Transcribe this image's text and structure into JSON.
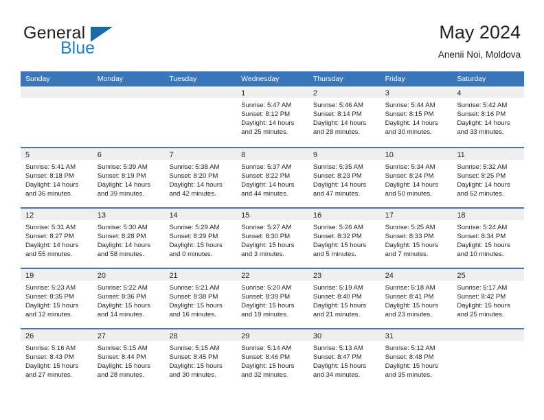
{
  "logo": {
    "word_one": "General",
    "word_two": "Blue",
    "triangle_icon": "triangle-icon"
  },
  "header": {
    "title": "May 2024",
    "location": "Anenii Noi, Moldova"
  },
  "colors": {
    "header_blue": "#3b76b8",
    "logo_blue": "#1f7fc4",
    "daynum_band": "#efefef",
    "text": "#231f20"
  },
  "weekdays": [
    "Sunday",
    "Monday",
    "Tuesday",
    "Wednesday",
    "Thursday",
    "Friday",
    "Saturday"
  ],
  "weeks": [
    [
      {
        "day": "",
        "lines": []
      },
      {
        "day": "",
        "lines": []
      },
      {
        "day": "",
        "lines": []
      },
      {
        "day": "1",
        "lines": [
          "Sunrise: 5:47 AM",
          "Sunset: 8:12 PM",
          "Daylight: 14 hours",
          "and 25 minutes."
        ]
      },
      {
        "day": "2",
        "lines": [
          "Sunrise: 5:46 AM",
          "Sunset: 8:14 PM",
          "Daylight: 14 hours",
          "and 28 minutes."
        ]
      },
      {
        "day": "3",
        "lines": [
          "Sunrise: 5:44 AM",
          "Sunset: 8:15 PM",
          "Daylight: 14 hours",
          "and 30 minutes."
        ]
      },
      {
        "day": "4",
        "lines": [
          "Sunrise: 5:42 AM",
          "Sunset: 8:16 PM",
          "Daylight: 14 hours",
          "and 33 minutes."
        ]
      }
    ],
    [
      {
        "day": "5",
        "lines": [
          "Sunrise: 5:41 AM",
          "Sunset: 8:18 PM",
          "Daylight: 14 hours",
          "and 36 minutes."
        ]
      },
      {
        "day": "6",
        "lines": [
          "Sunrise: 5:39 AM",
          "Sunset: 8:19 PM",
          "Daylight: 14 hours",
          "and 39 minutes."
        ]
      },
      {
        "day": "7",
        "lines": [
          "Sunrise: 5:38 AM",
          "Sunset: 8:20 PM",
          "Daylight: 14 hours",
          "and 42 minutes."
        ]
      },
      {
        "day": "8",
        "lines": [
          "Sunrise: 5:37 AM",
          "Sunset: 8:22 PM",
          "Daylight: 14 hours",
          "and 44 minutes."
        ]
      },
      {
        "day": "9",
        "lines": [
          "Sunrise: 5:35 AM",
          "Sunset: 8:23 PM",
          "Daylight: 14 hours",
          "and 47 minutes."
        ]
      },
      {
        "day": "10",
        "lines": [
          "Sunrise: 5:34 AM",
          "Sunset: 8:24 PM",
          "Daylight: 14 hours",
          "and 50 minutes."
        ]
      },
      {
        "day": "11",
        "lines": [
          "Sunrise: 5:32 AM",
          "Sunset: 8:25 PM",
          "Daylight: 14 hours",
          "and 52 minutes."
        ]
      }
    ],
    [
      {
        "day": "12",
        "lines": [
          "Sunrise: 5:31 AM",
          "Sunset: 8:27 PM",
          "Daylight: 14 hours",
          "and 55 minutes."
        ]
      },
      {
        "day": "13",
        "lines": [
          "Sunrise: 5:30 AM",
          "Sunset: 8:28 PM",
          "Daylight: 14 hours",
          "and 58 minutes."
        ]
      },
      {
        "day": "14",
        "lines": [
          "Sunrise: 5:29 AM",
          "Sunset: 8:29 PM",
          "Daylight: 15 hours",
          "and 0 minutes."
        ]
      },
      {
        "day": "15",
        "lines": [
          "Sunrise: 5:27 AM",
          "Sunset: 8:30 PM",
          "Daylight: 15 hours",
          "and 3 minutes."
        ]
      },
      {
        "day": "16",
        "lines": [
          "Sunrise: 5:26 AM",
          "Sunset: 8:32 PM",
          "Daylight: 15 hours",
          "and 5 minutes."
        ]
      },
      {
        "day": "17",
        "lines": [
          "Sunrise: 5:25 AM",
          "Sunset: 8:33 PM",
          "Daylight: 15 hours",
          "and 7 minutes."
        ]
      },
      {
        "day": "18",
        "lines": [
          "Sunrise: 5:24 AM",
          "Sunset: 8:34 PM",
          "Daylight: 15 hours",
          "and 10 minutes."
        ]
      }
    ],
    [
      {
        "day": "19",
        "lines": [
          "Sunrise: 5:23 AM",
          "Sunset: 8:35 PM",
          "Daylight: 15 hours",
          "and 12 minutes."
        ]
      },
      {
        "day": "20",
        "lines": [
          "Sunrise: 5:22 AM",
          "Sunset: 8:36 PM",
          "Daylight: 15 hours",
          "and 14 minutes."
        ]
      },
      {
        "day": "21",
        "lines": [
          "Sunrise: 5:21 AM",
          "Sunset: 8:38 PM",
          "Daylight: 15 hours",
          "and 16 minutes."
        ]
      },
      {
        "day": "22",
        "lines": [
          "Sunrise: 5:20 AM",
          "Sunset: 8:39 PM",
          "Daylight: 15 hours",
          "and 19 minutes."
        ]
      },
      {
        "day": "23",
        "lines": [
          "Sunrise: 5:19 AM",
          "Sunset: 8:40 PM",
          "Daylight: 15 hours",
          "and 21 minutes."
        ]
      },
      {
        "day": "24",
        "lines": [
          "Sunrise: 5:18 AM",
          "Sunset: 8:41 PM",
          "Daylight: 15 hours",
          "and 23 minutes."
        ]
      },
      {
        "day": "25",
        "lines": [
          "Sunrise: 5:17 AM",
          "Sunset: 8:42 PM",
          "Daylight: 15 hours",
          "and 25 minutes."
        ]
      }
    ],
    [
      {
        "day": "26",
        "lines": [
          "Sunrise: 5:16 AM",
          "Sunset: 8:43 PM",
          "Daylight: 15 hours",
          "and 27 minutes."
        ]
      },
      {
        "day": "27",
        "lines": [
          "Sunrise: 5:15 AM",
          "Sunset: 8:44 PM",
          "Daylight: 15 hours",
          "and 28 minutes."
        ]
      },
      {
        "day": "28",
        "lines": [
          "Sunrise: 5:15 AM",
          "Sunset: 8:45 PM",
          "Daylight: 15 hours",
          "and 30 minutes."
        ]
      },
      {
        "day": "29",
        "lines": [
          "Sunrise: 5:14 AM",
          "Sunset: 8:46 PM",
          "Daylight: 15 hours",
          "and 32 minutes."
        ]
      },
      {
        "day": "30",
        "lines": [
          "Sunrise: 5:13 AM",
          "Sunset: 8:47 PM",
          "Daylight: 15 hours",
          "and 34 minutes."
        ]
      },
      {
        "day": "31",
        "lines": [
          "Sunrise: 5:12 AM",
          "Sunset: 8:48 PM",
          "Daylight: 15 hours",
          "and 35 minutes."
        ]
      },
      {
        "day": "",
        "lines": []
      }
    ]
  ]
}
